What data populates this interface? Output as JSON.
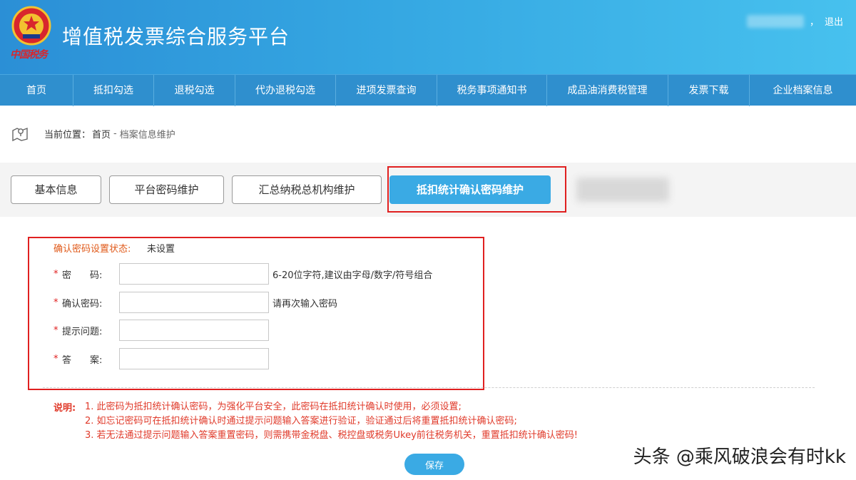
{
  "header": {
    "emblem_text": "中国税务",
    "title": "增值税发票综合服务平台",
    "user_separator": "，",
    "logout_label": "退出"
  },
  "nav": {
    "items": [
      {
        "label": "首页"
      },
      {
        "label": "抵扣勾选"
      },
      {
        "label": "退税勾选"
      },
      {
        "label": "代办退税勾选"
      },
      {
        "label": "进项发票查询"
      },
      {
        "label": "税务事项通知书"
      },
      {
        "label": "成品油消费税管理"
      },
      {
        "label": "发票下载"
      },
      {
        "label": "企业档案信息"
      }
    ]
  },
  "breadcrumb": {
    "prefix": "当前位置：",
    "home": "首页",
    "separator": "-",
    "current": "档案信息维护"
  },
  "tabs": [
    {
      "label": "基本信息"
    },
    {
      "label": "平台密码维护"
    },
    {
      "label": "汇总纳税总机构维护"
    },
    {
      "label": "抵扣统计确认密码维护"
    }
  ],
  "form": {
    "status_label": "确认密码设置状态:",
    "status_value": "未设置",
    "required_mark": "*",
    "fields": [
      {
        "label": "密　　码:",
        "value": "",
        "hint": "6-20位字符,建议由字母/数字/符号组合"
      },
      {
        "label": "确认密码:",
        "value": "",
        "hint": "请再次输入密码"
      },
      {
        "label": "提示问题:",
        "value": "",
        "hint": ""
      },
      {
        "label": "答　　案:",
        "value": "",
        "hint": ""
      }
    ]
  },
  "notes": {
    "label": "说明:",
    "lines": [
      "1. 此密码为抵扣统计确认密码，为强化平台安全，此密码在抵扣统计确认时使用，必须设置;",
      "2. 如忘记密码可在抵扣统计确认时通过提示问题输入答案进行验证，验证通过后将重置抵扣统计确认密码;",
      "3. 若无法通过提示问题输入答案重置密码，则需携带金税盘、税控盘或税务Ukey前往税务机关，重置抵扣统计确认密码!"
    ]
  },
  "actions": {
    "save_label": "保存"
  },
  "watermark": "头条 @乘风破浪会有时kk",
  "colors": {
    "header_blue": "#2b8fd6",
    "nav_blue": "#2f8fce",
    "active_tab": "#3aaae4",
    "highlight_red": "#e02020",
    "note_red": "#e03a2a"
  }
}
